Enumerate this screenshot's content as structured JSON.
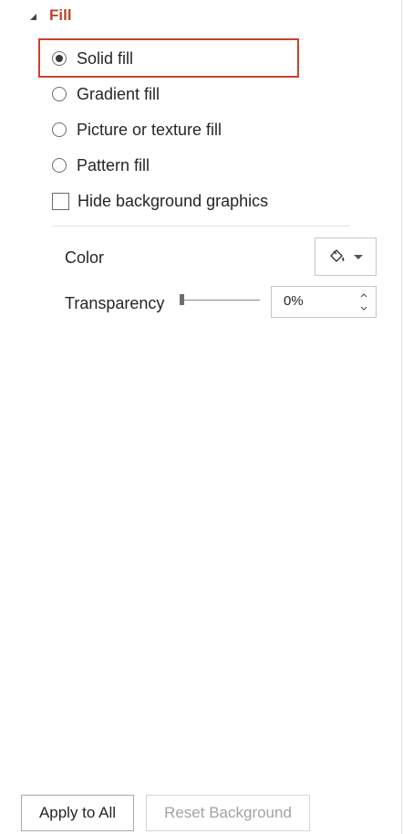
{
  "section": {
    "title": "Fill",
    "expanded": true
  },
  "fill_options": [
    {
      "label": "Solid fill",
      "selected": true
    },
    {
      "label": "Gradient fill",
      "selected": false
    },
    {
      "label": "Picture or texture fill",
      "selected": false
    },
    {
      "label": "Pattern fill",
      "selected": false
    }
  ],
  "hide_background": {
    "label": "Hide background graphics",
    "checked": false
  },
  "color": {
    "label": "Color",
    "icon": "paint-bucket-icon"
  },
  "transparency": {
    "label": "Transparency",
    "value": "0%",
    "level": 0
  },
  "buttons": {
    "apply_all": "Apply to All",
    "reset": "Reset Background"
  },
  "colors": {
    "accent": "#b7472a",
    "highlight": "#c8432c"
  }
}
